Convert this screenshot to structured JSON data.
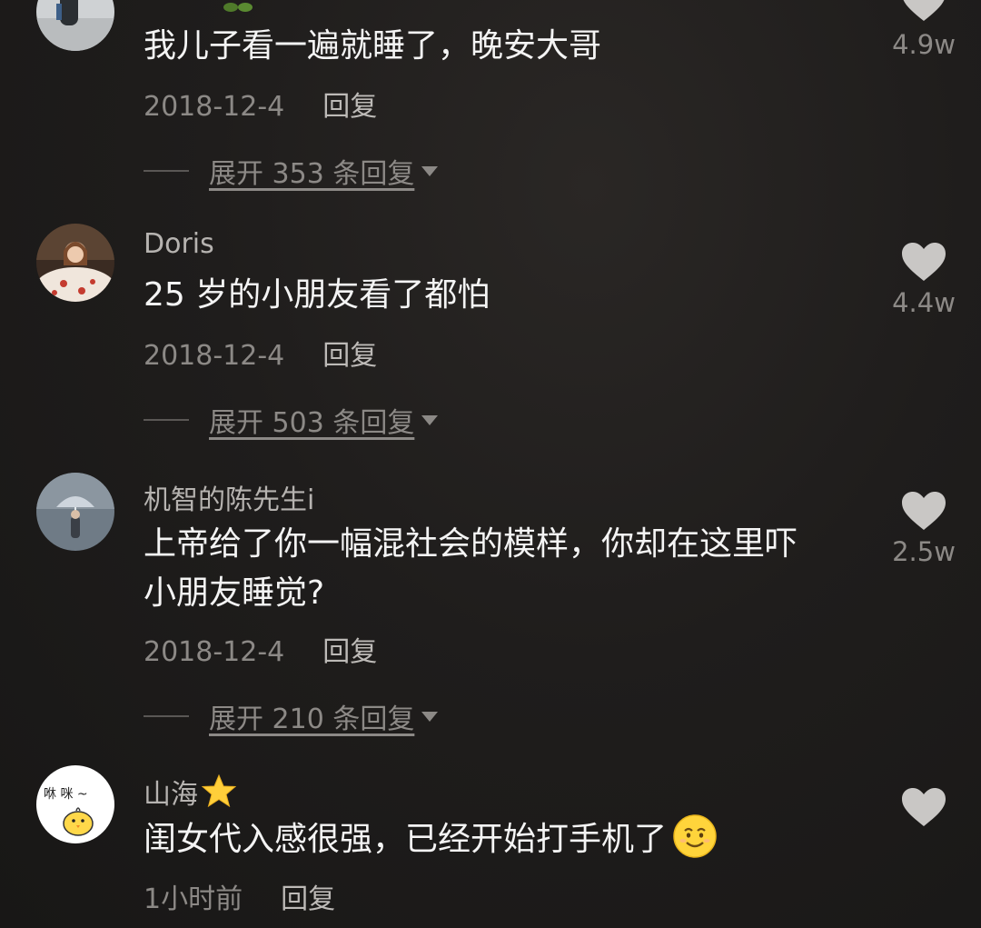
{
  "comments": [
    {
      "username": "",
      "text": "我儿子看一遍就睡了，晚安大哥",
      "date": "2018-12-4",
      "reply_label": "回复",
      "expand_label": "展开 353 条回复",
      "likes": "4.9w"
    },
    {
      "username": "Doris",
      "text": "25 岁的小朋友看了都怕",
      "date": "2018-12-4",
      "reply_label": "回复",
      "expand_label": "展开 503 条回复",
      "likes": "4.4w"
    },
    {
      "username": "机智的陈先生i",
      "text_line1": "上帝给了你一幅混社会的模样，你却在这里吓",
      "text_line2": "小朋友睡觉?",
      "date": "2018-12-4",
      "reply_label": "回复",
      "expand_label": "展开 210 条回复",
      "likes": "2.5w"
    },
    {
      "username": "山海",
      "text": "闺女代入感很强，已经开始打手机了",
      "date": "1小时前",
      "reply_label": "回复",
      "likes": ""
    }
  ],
  "avatar4_text": "咻 咪 ~",
  "icons": {
    "like": "heart-icon",
    "caret": "caret-down-icon",
    "star": "star-icon",
    "emoji": "smile-emoji-icon"
  },
  "colors": {
    "background": "#1d1b1a",
    "text_primary": "#f4f4f4",
    "text_secondary": "#8c8986",
    "heart": "#c9c7c5",
    "star": "#ffcf3a"
  }
}
